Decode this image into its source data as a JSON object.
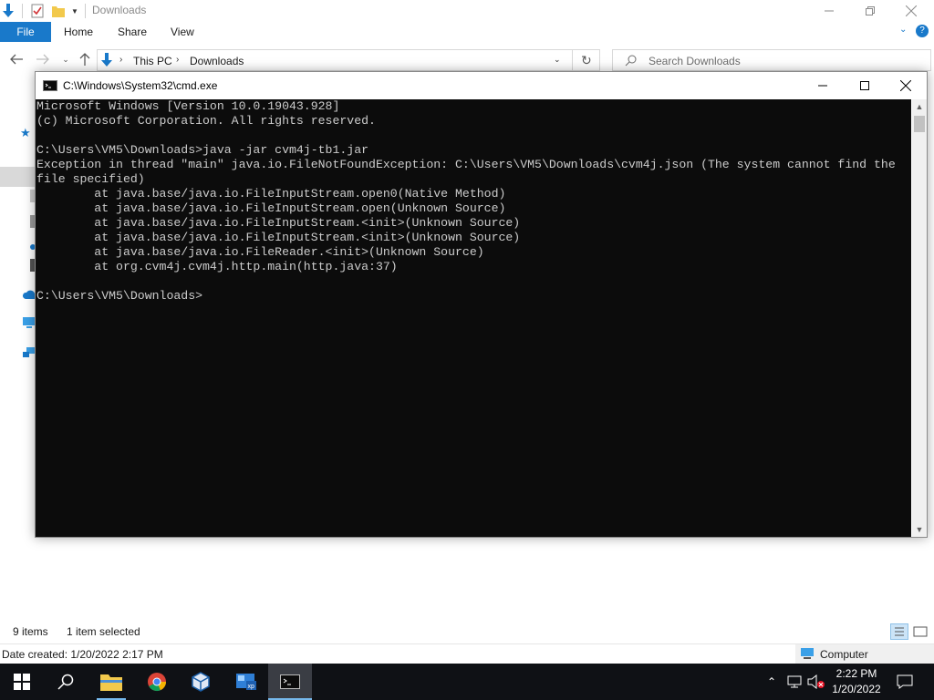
{
  "explorer": {
    "title": "Downloads",
    "ribbon": {
      "file": "File",
      "home": "Home",
      "share": "Share",
      "view": "View"
    },
    "address": {
      "crumbs": [
        "This PC",
        "Downloads"
      ]
    },
    "search_placeholder": "Search Downloads",
    "status": {
      "items": "9 items",
      "selected": "1 item selected"
    },
    "details": {
      "date_created": "Date created: 1/20/2022 2:17 PM",
      "location": "Computer"
    }
  },
  "cmd": {
    "title": "C:\\Windows\\System32\\cmd.exe",
    "lines": [
      "Microsoft Windows [Version 10.0.19043.928]",
      "(c) Microsoft Corporation. All rights reserved.",
      "",
      "C:\\Users\\VM5\\Downloads>java -jar cvm4j-tb1.jar",
      "Exception in thread \"main\" java.io.FileNotFoundException: C:\\Users\\VM5\\Downloads\\cvm4j.json (The system cannot find the",
      "file specified)",
      "        at java.base/java.io.FileInputStream.open0(Native Method)",
      "        at java.base/java.io.FileInputStream.open(Unknown Source)",
      "        at java.base/java.io.FileInputStream.<init>(Unknown Source)",
      "        at java.base/java.io.FileInputStream.<init>(Unknown Source)",
      "        at java.base/java.io.FileReader.<init>(Unknown Source)",
      "        at org.cvm4j.cvm4j.http.main(http.java:37)",
      "",
      "C:\\Users\\VM5\\Downloads>"
    ]
  },
  "taskbar": {
    "apps": [
      "start-icon",
      "search-icon",
      "file-explorer-icon",
      "chrome-icon",
      "virtualbox-icon",
      "xp-mode-icon",
      "cmd-icon"
    ],
    "clock": {
      "time": "2:22 PM",
      "date": "1/20/2022"
    }
  },
  "colors": {
    "accent": "#1979ca",
    "console_bg": "#0c0c0c",
    "console_fg": "#cccccc",
    "taskbar": "#0f1115"
  }
}
